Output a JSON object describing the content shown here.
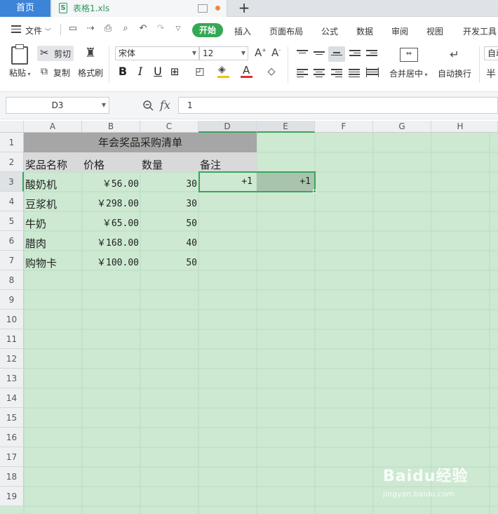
{
  "tabs": {
    "home": "首页",
    "file": "表格1.xls",
    "new_tab": "+"
  },
  "menu": {
    "file": "文件",
    "items": [
      "开始",
      "插入",
      "页面布局",
      "公式",
      "数据",
      "审阅",
      "视图",
      "开发工具"
    ]
  },
  "ribbon": {
    "paste": "粘贴",
    "cut": "剪切",
    "copy": "复制",
    "format_painter": "格式刷",
    "font_name": "宋体",
    "font_size": "12",
    "merge_center": "合并居中",
    "wrap_text": "自动换行",
    "cut_off_1": "自动",
    "cut_off_2": "半"
  },
  "formula_bar": {
    "name_box": "D3",
    "fx": "fx",
    "value": "1"
  },
  "columns": [
    "A",
    "B",
    "C",
    "D",
    "E",
    "F",
    "G",
    "H"
  ],
  "rows": [
    "1",
    "2",
    "3",
    "4",
    "5",
    "6",
    "7",
    "8",
    "9",
    "10",
    "11",
    "12",
    "13",
    "14",
    "15",
    "16",
    "17",
    "18",
    "19"
  ],
  "sheet": {
    "title": "年会奖品采购清单",
    "headers": [
      "奖品名称",
      "价格",
      "数量",
      "备注"
    ],
    "data": [
      {
        "name": "酸奶机",
        "price": "￥56.00",
        "qty": "30",
        "d": "+1",
        "e": "+1"
      },
      {
        "name": "豆浆机",
        "price": "￥298.00",
        "qty": "30"
      },
      {
        "name": "牛奶",
        "price": "￥65.00",
        "qty": "50"
      },
      {
        "name": "腊肉",
        "price": "￥168.00",
        "qty": "40"
      },
      {
        "name": "购物卡",
        "price": "￥100.00",
        "qty": "50"
      }
    ]
  },
  "watermark": {
    "brand": "Baidu经验",
    "url": "jingyan.baidu.com"
  },
  "colors": {
    "accent": "#35a853",
    "home_tab": "#3c84d8",
    "sheet_bg": "#cde9d2",
    "title_bg": "#a6a6a6",
    "header_bg": "#d9d9d9",
    "selection": "#3aa55c"
  }
}
